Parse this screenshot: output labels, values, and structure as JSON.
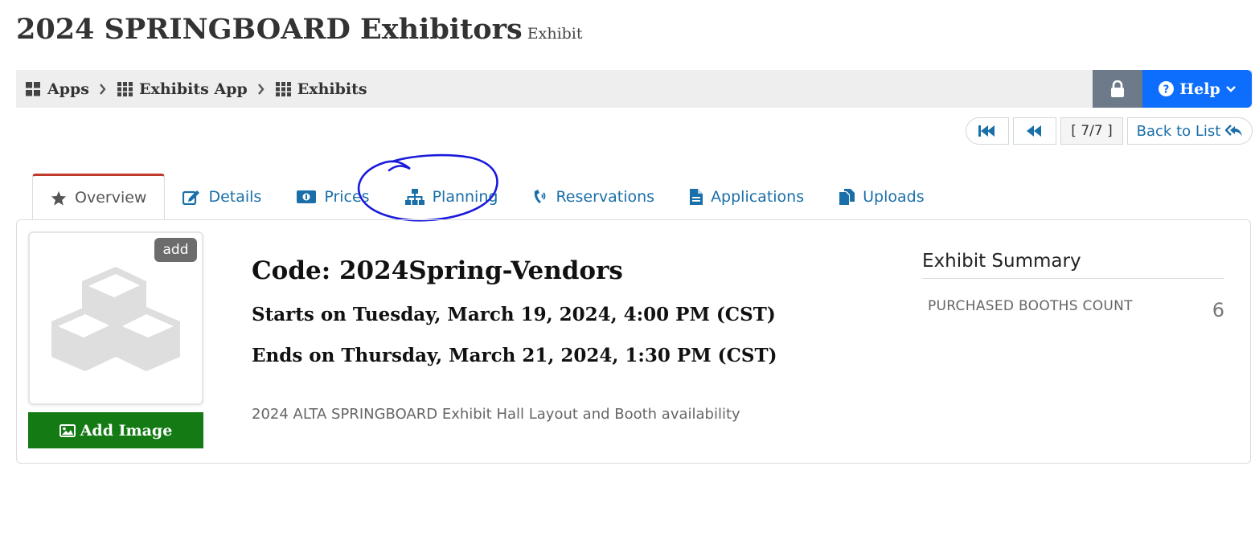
{
  "header": {
    "title": "2024 SPRINGBOARD Exhibitors",
    "subtitle": "Exhibit"
  },
  "breadcrumb": {
    "items": [
      {
        "label": "Apps",
        "icon": "th-large-icon"
      },
      {
        "label": "Exhibits App",
        "icon": "th-icon"
      },
      {
        "label": "Exhibits",
        "icon": "th-icon"
      }
    ]
  },
  "toolbar": {
    "lock_icon": "lock-icon",
    "help_label": "Help"
  },
  "pager": {
    "position": "[ 7/7 ]",
    "back_label": "Back to List"
  },
  "tabs": [
    {
      "label": "Overview",
      "icon": "star-icon",
      "active": true
    },
    {
      "label": "Details",
      "icon": "edit-icon"
    },
    {
      "label": "Prices",
      "icon": "money-bill-icon"
    },
    {
      "label": "Planning",
      "icon": "sitemap-icon"
    },
    {
      "label": "Reservations",
      "icon": "phone-volume-icon"
    },
    {
      "label": "Applications",
      "icon": "file-icon"
    },
    {
      "label": "Uploads",
      "icon": "copy-icon"
    }
  ],
  "overview": {
    "image_badge": "add",
    "add_image_label": "Add Image",
    "code": "Code: 2024Spring-Vendors",
    "starts": "Starts on Tuesday, March 19, 2024, 4:00 PM (CST)",
    "ends": "Ends on Thursday, March 21, 2024, 1:30 PM (CST)",
    "description": "2024 ALTA SPRINGBOARD Exhibit Hall Layout and Booth availability"
  },
  "summary": {
    "title": "Exhibit Summary",
    "rows": [
      {
        "label": "PURCHASED BOOTHS COUNT",
        "value": "6"
      }
    ]
  },
  "colors": {
    "help_button": "#0d6efd",
    "lock_button": "#6c7a89",
    "add_image_button": "#137a14",
    "active_tab_accent": "#c0392b",
    "link": "#1a6fa8",
    "annotation": "#1a1adc"
  }
}
